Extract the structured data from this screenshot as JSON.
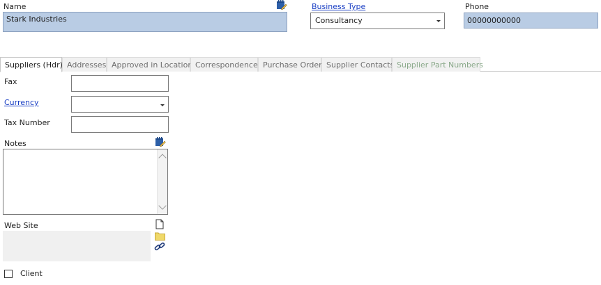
{
  "header": {
    "name_label": "Name",
    "name_value": "Stark Industries",
    "business_type_label": "Business Type",
    "business_type_value": "Consultancy",
    "phone_label": "Phone",
    "phone_value": "00000000000"
  },
  "tabs": [
    {
      "label": "Suppliers (Hdr)",
      "active": true
    },
    {
      "label": "Addresses",
      "active": false
    },
    {
      "label": "Approved in Location",
      "active": false
    },
    {
      "label": "Correspondence",
      "active": false
    },
    {
      "label": "Purchase Order",
      "active": false
    },
    {
      "label": "Supplier Contacts",
      "active": false
    },
    {
      "label": "Supplier Part Numbers",
      "active": false
    }
  ],
  "form": {
    "fax_label": "Fax",
    "fax_value": "",
    "currency_label": "Currency",
    "currency_value": "",
    "tax_number_label": "Tax Number",
    "tax_number_value": "",
    "notes_label": "Notes",
    "notes_value": "",
    "website_label": "Web Site",
    "client_label": "Client",
    "client_checked": false
  },
  "colors": {
    "accent_link": "#1a3fc4",
    "readonly_field": "#b9cce4"
  },
  "icons": [
    "edit-notes-icon",
    "new-document-icon",
    "folder-icon",
    "link-icon"
  ]
}
